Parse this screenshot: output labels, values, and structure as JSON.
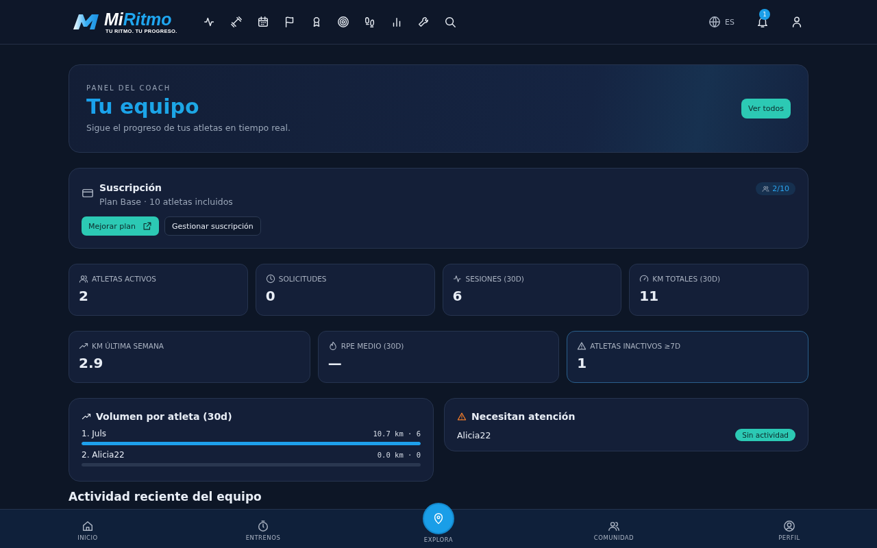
{
  "brand": {
    "name_a": "Mi",
    "name_b": "Ritmo",
    "tagline": "TU RITMO. TU PROGRESO."
  },
  "header": {
    "language": "ES",
    "notifications": "1"
  },
  "hero": {
    "eyebrow": "PANEL DEL COACH",
    "title": "Tu equipo",
    "subtitle": "Sigue el progreso de tus atletas en tiempo real.",
    "button": "Ver todos"
  },
  "subscription": {
    "title": "Suscripción",
    "plan": "Plan Base · 10 atletas incluidos",
    "usage": "2/10",
    "buttons": [
      {
        "label": "Mejorar plan",
        "kind": "primary"
      },
      {
        "label": "Gestionar suscripción",
        "kind": "secondary"
      }
    ]
  },
  "stats": [
    {
      "label": "ATLETAS ACTIVOS",
      "value": "2",
      "highlighted": false
    },
    {
      "label": "SOLICITUDES",
      "value": "0",
      "highlighted": false
    },
    {
      "label": "SESIONES (30D)",
      "value": "6",
      "highlighted": false
    },
    {
      "label": "KM TOTALES (30D)",
      "value": "11",
      "highlighted": false
    }
  ],
  "stats_2": [
    {
      "label": "KM ÚLTIMA SEMANA",
      "value": "2.9",
      "highlighted": false
    },
    {
      "label": "RPE MEDIO (30D)",
      "value": "—",
      "highlighted": false
    },
    {
      "label": "ATLETAS INACTIVOS ≥7D",
      "value": "1",
      "highlighted": true
    }
  ],
  "volume": {
    "title": "Volumen por atleta (30d)",
    "rows": [
      {
        "name": "1. Juls",
        "reading": "10.7 km · 6",
        "level": 1.0
      },
      {
        "name": "2. Alicia22",
        "reading": "0.0 km · 0",
        "level": 0.0
      }
    ]
  },
  "attention": {
    "title": "Necesitan atención",
    "rows": [
      {
        "name": "Alicia22",
        "tag": "Sin actividad"
      }
    ]
  },
  "section_heading": "Actividad reciente del equipo",
  "bottom_nav": [
    {
      "label": "INICIO",
      "kind": "tab"
    },
    {
      "label": "ENTRENOS",
      "kind": "tab"
    },
    {
      "label": "EXPLORA",
      "kind": "fab"
    },
    {
      "label": "COMUNIDAD",
      "kind": "tab"
    },
    {
      "label": "PERFIL",
      "kind": "tab"
    }
  ]
}
